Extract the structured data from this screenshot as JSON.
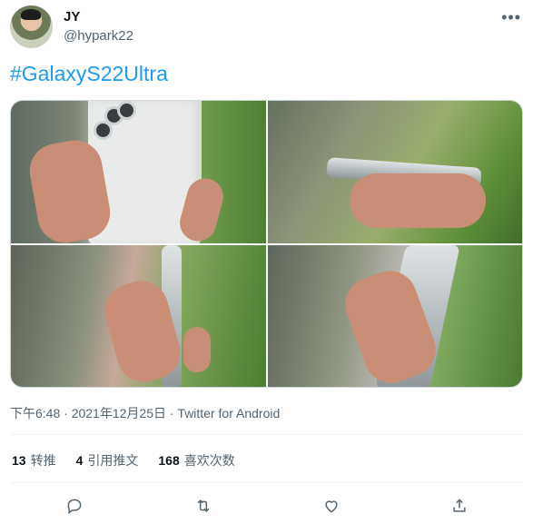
{
  "tweet": {
    "name": "JY",
    "handle": "@hypark22",
    "more_icon": "ellipsis-icon",
    "text": "#GalaxyS22Ultra",
    "meta": "下午6:48 · 2021年12月25日 · Twitter for Android",
    "stats": [
      {
        "count": "13",
        "label": "转推"
      },
      {
        "count": "4",
        "label": "引用推文"
      },
      {
        "count": "168",
        "label": "喜欢次数"
      }
    ],
    "actions": [
      "reply-icon",
      "retweet-icon",
      "like-icon",
      "share-icon"
    ],
    "brand_color": "#1d9bf0"
  }
}
